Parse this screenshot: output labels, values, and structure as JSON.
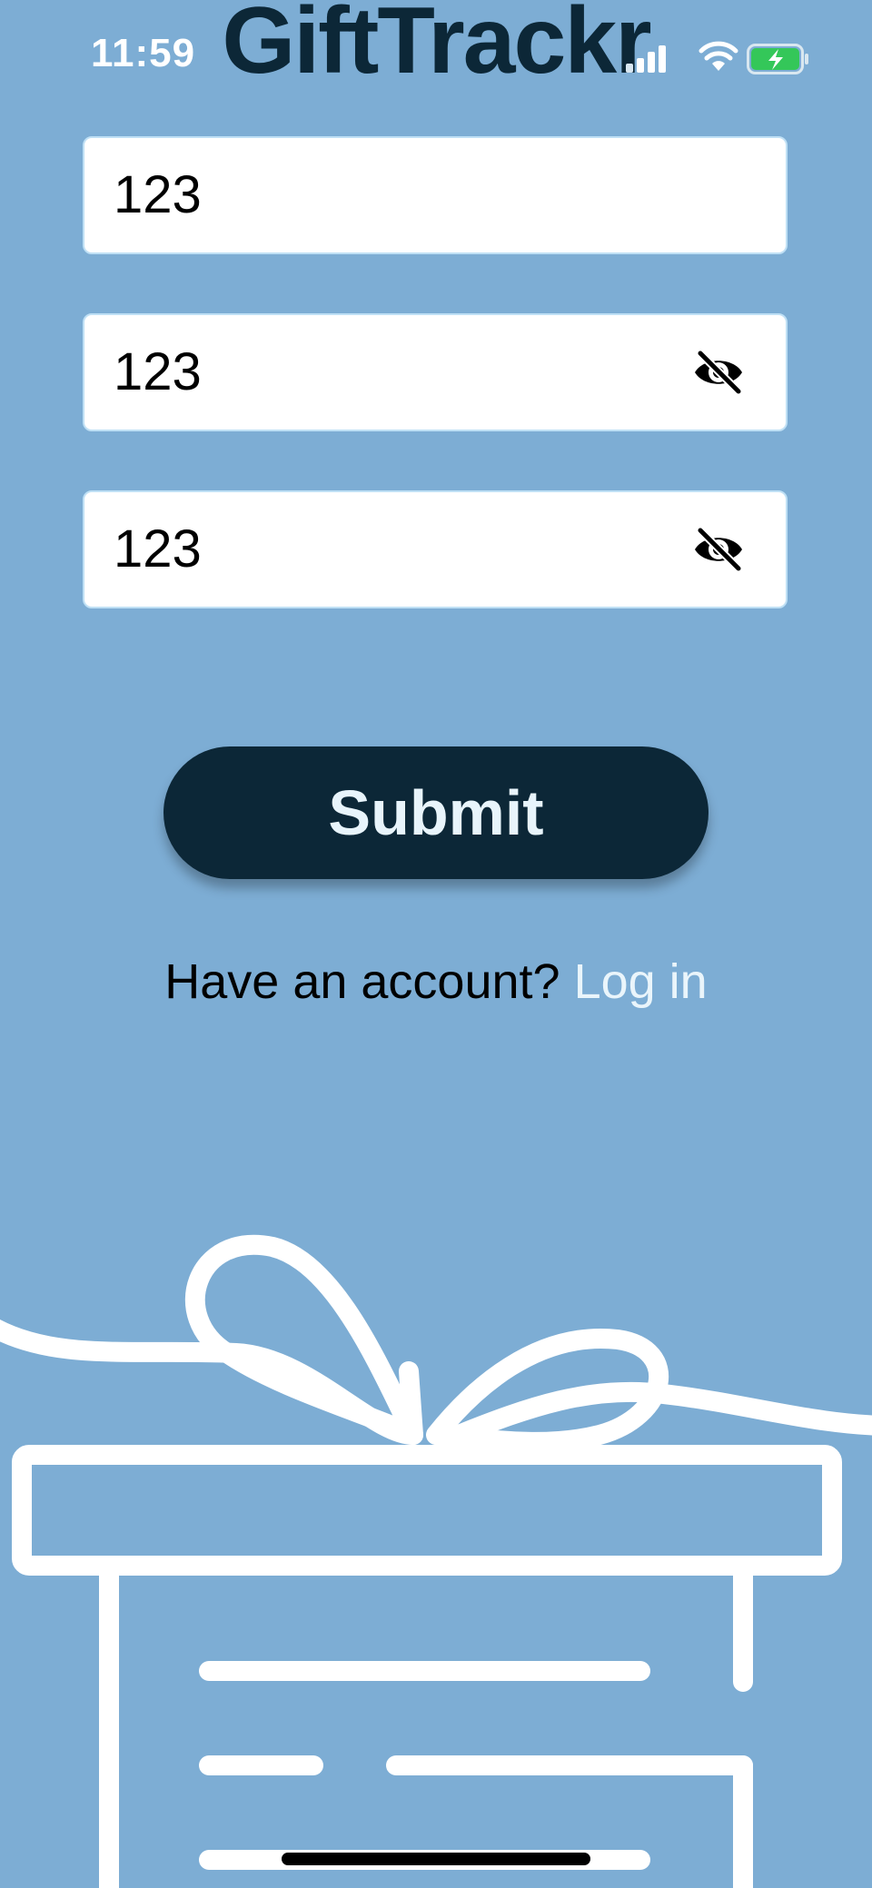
{
  "app": {
    "title": "GiftTrackr"
  },
  "status_bar": {
    "time": "11:59",
    "icons": [
      "signal-icon",
      "wifi-icon",
      "battery-charging-icon"
    ],
    "battery_color": "#34c759"
  },
  "form": {
    "fields": [
      {
        "value": "123",
        "has_visibility_toggle": false
      },
      {
        "value": "123",
        "has_visibility_toggle": true,
        "toggle_icon": "eye-off-icon"
      },
      {
        "value": "123",
        "has_visibility_toggle": true,
        "toggle_icon": "eye-off-icon"
      }
    ],
    "submit_label": "Submit"
  },
  "login_prompt": {
    "text": "Have an account?",
    "link_label": "Log in"
  },
  "colors": {
    "background": "#7dadd4",
    "accent_dark": "#0c2737",
    "field_border": "#bfe0f5",
    "link": "#eaf5fb"
  }
}
